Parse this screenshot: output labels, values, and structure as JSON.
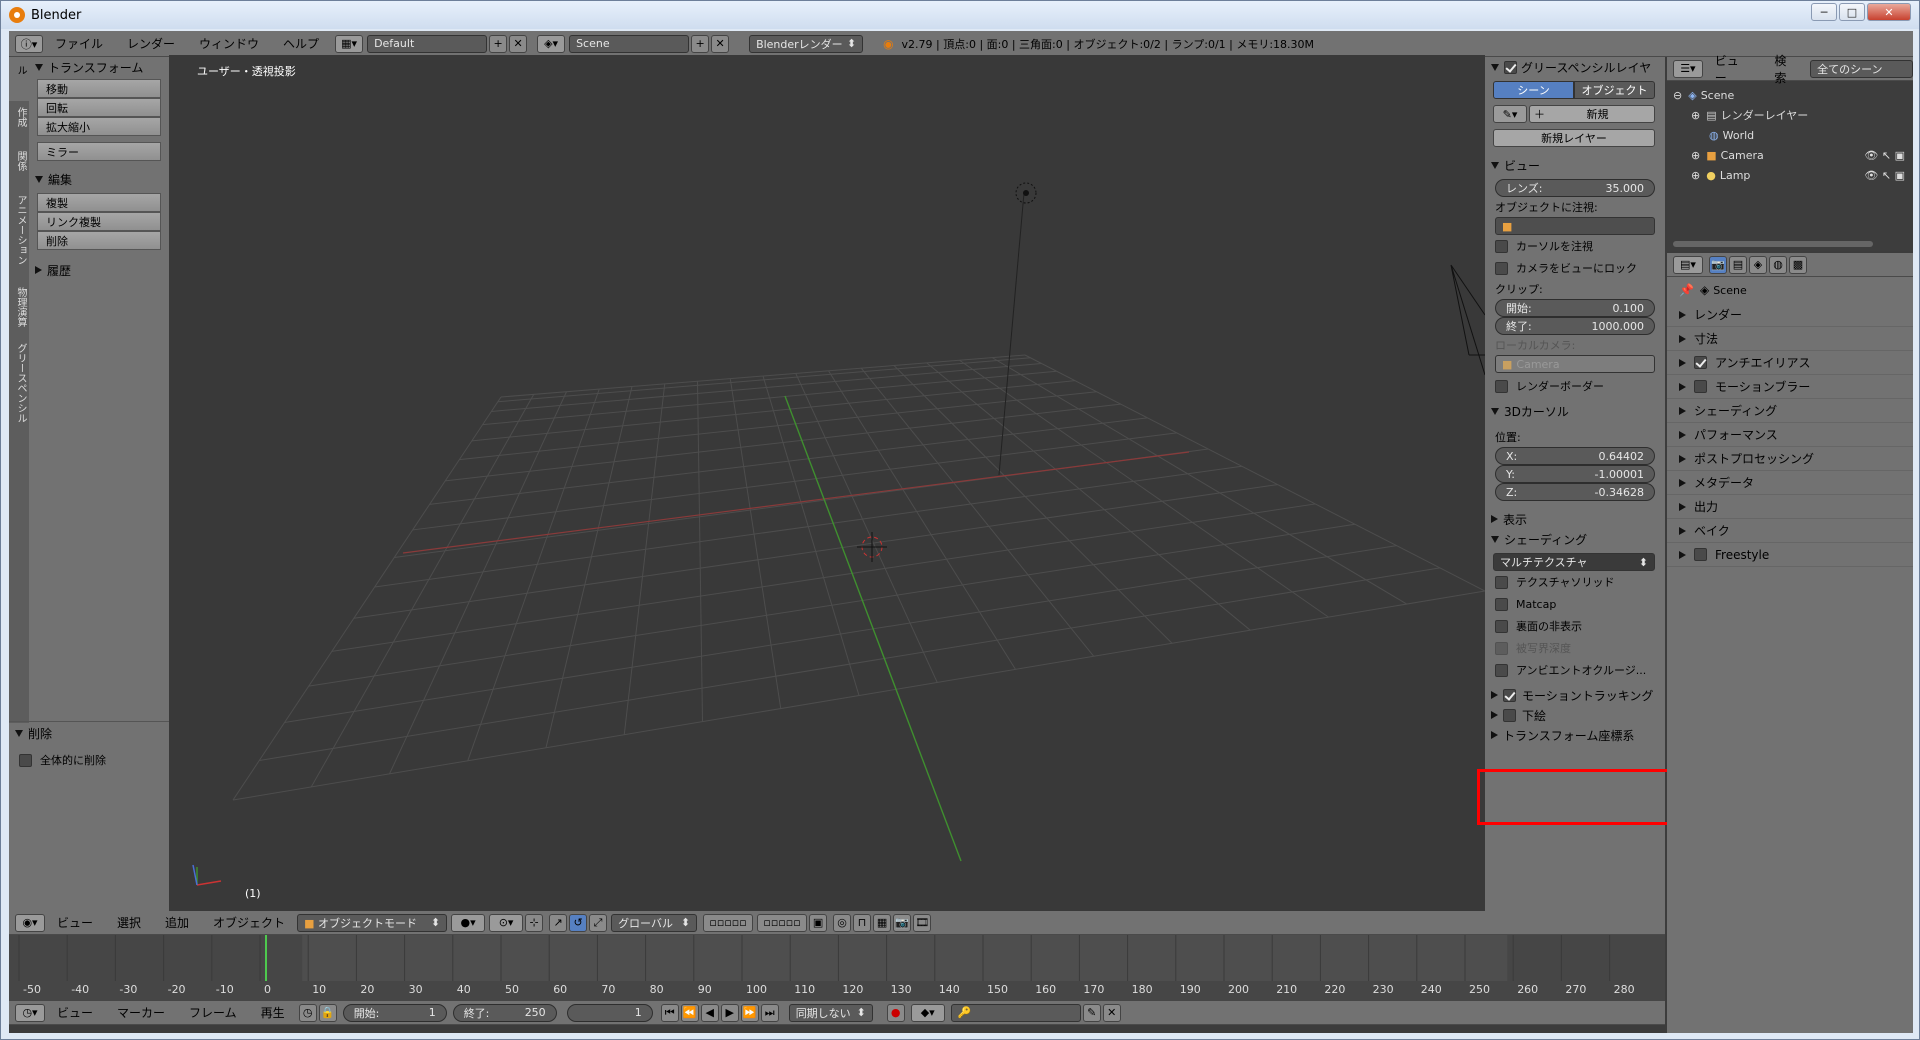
{
  "window": {
    "title": "Blender",
    "buttons": [
      "─",
      "□",
      "✕"
    ]
  },
  "info_header": {
    "menus": [
      "ファイル",
      "レンダー",
      "ウィンドウ",
      "ヘルプ"
    ],
    "layout": "Default",
    "scene": "Scene",
    "engine": "Blenderレンダー",
    "stats": "v2.79 | 頂点:0 | 面:0 | 三角面:0 | オブジェクト:0/2 | ランプ:0/1 | メモリ:18.30M"
  },
  "left_tabs": [
    "ツール",
    "作成",
    "関係",
    "アニメーション",
    "物理演算",
    "グリースペンシル"
  ],
  "toolshelf": {
    "transform": {
      "title": "トランスフォーム",
      "buttons": [
        "移動",
        "回転",
        "拡大縮小",
        "ミラー"
      ]
    },
    "edit": {
      "title": "編集",
      "buttons": [
        "複製",
        "リンク複製",
        "削除"
      ]
    },
    "history": {
      "title": "履歴"
    },
    "delete_panel": {
      "title": "削除",
      "option": "全体的に削除"
    }
  },
  "viewport": {
    "label": "ユーザー・透視投影",
    "frame": "(1)"
  },
  "npanel": {
    "grease": {
      "title": "グリースペンシルレイヤ",
      "tab_scene": "シーン",
      "tab_object": "オブジェクト",
      "new": "新規",
      "new_layer": "新規レイヤー"
    },
    "view": {
      "title": "ビュー",
      "lens_label": "レンズ:",
      "lens_value": "35.000",
      "lock_object": "オブジェクトに注視:",
      "lock_cursor": "カーソルを注視",
      "lock_camera": "カメラをビューにロック",
      "clip": "クリップ:",
      "start_label": "開始:",
      "start_value": "0.100",
      "end_label": "終了:",
      "end_value": "1000.000",
      "local_camera": "ローカルカメラ:",
      "camera": "Camera",
      "render_border": "レンダーボーダー"
    },
    "cursor": {
      "title": "3Dカーソル",
      "position": "位置:",
      "x_label": "X:",
      "x": "0.64402",
      "y_label": "Y:",
      "y": "-1.00001",
      "z_label": "Z:",
      "z": "-0.34628"
    },
    "display": {
      "title": "表示"
    },
    "shading": {
      "title": "シェーディング",
      "mode": "マルチテクスチャ",
      "opts": [
        "テクスチャソリッド",
        "Matcap",
        "裏面の非表示",
        "被写界深度",
        "アンビエントオクルージ..."
      ]
    },
    "motion_tracking": "モーショントラッキング",
    "background": "下絵",
    "transform_orient": "トランスフォーム座標系"
  },
  "outliner": {
    "menus": [
      "ビュー",
      "検索"
    ],
    "filter": "全てのシーン",
    "items": [
      "Scene",
      "レンダーレイヤー",
      "World",
      "Camera",
      "Lamp"
    ]
  },
  "properties": {
    "scene": "Scene",
    "panels": [
      "レンダー",
      "寸法",
      "アンチエイリアス",
      "モーションブラー",
      "シェーディング",
      "パフォーマンス",
      "ポストプロセッシング",
      "メタデータ",
      "出力",
      "ベイク",
      "Freestyle"
    ]
  },
  "view3d_header": {
    "menus": [
      "ビュー",
      "選択",
      "追加",
      "オブジェクト"
    ],
    "mode": "オブジェクトモード",
    "orientation": "グローバル"
  },
  "timeline": {
    "ticks": [
      "-50",
      "-40",
      "-30",
      "-20",
      "-10",
      "0",
      "10",
      "20",
      "30",
      "40",
      "50",
      "60",
      "70",
      "80",
      "90",
      "100",
      "110",
      "120",
      "130",
      "140",
      "150",
      "160",
      "170",
      "180",
      "190",
      "200",
      "210",
      "220",
      "230",
      "240",
      "250",
      "260",
      "270",
      "280"
    ],
    "menus": [
      "ビュー",
      "マーカー",
      "フレーム",
      "再生"
    ],
    "start_label": "開始:",
    "start": "1",
    "end_label": "終了:",
    "end": "250",
    "current": "1",
    "sync": "同期しない"
  },
  "colors": {
    "accent": "#5680c2",
    "highlight_box": "#ff0000"
  }
}
